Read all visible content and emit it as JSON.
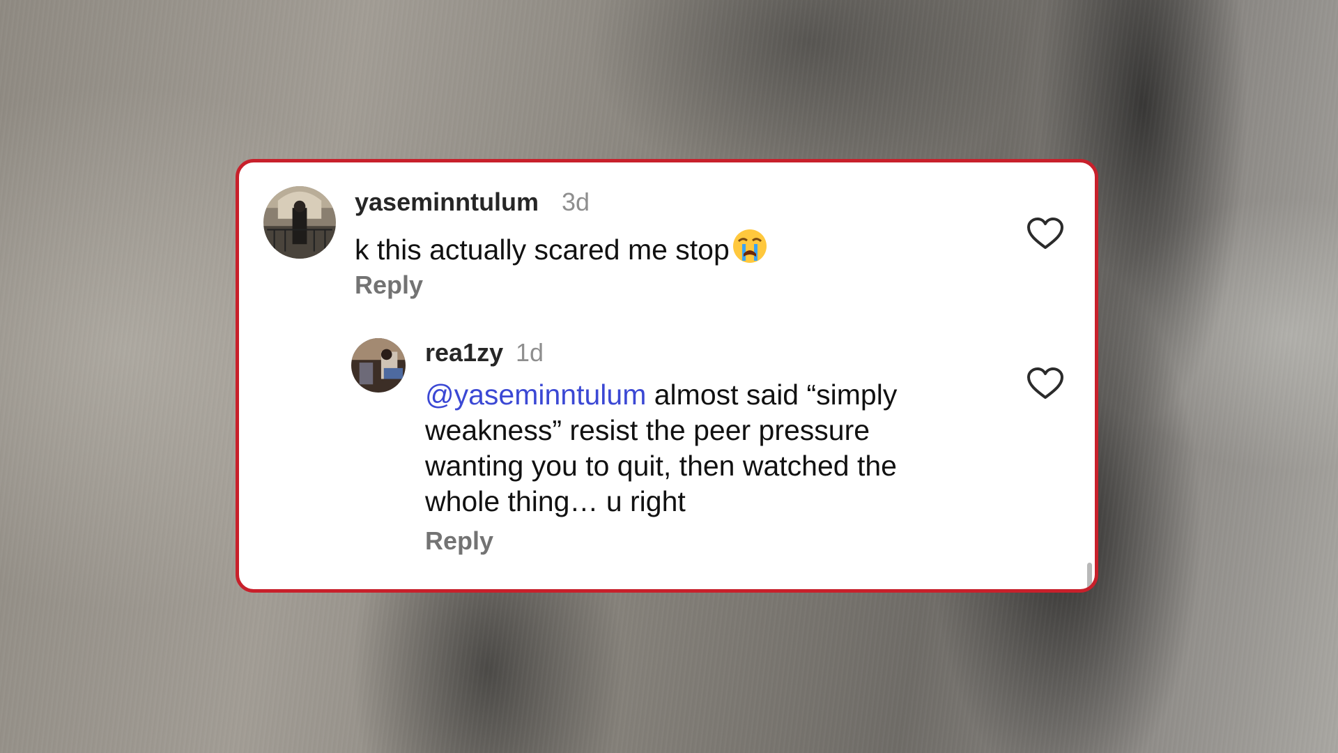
{
  "comments": [
    {
      "username": "yaseminntulum",
      "time": "3d",
      "text": "k this actually scared me stop",
      "emoji": "loudly-crying-face",
      "reply_label": "Reply",
      "like_icon": "heart-outline-icon"
    },
    {
      "username": "rea1zy",
      "time": "1d",
      "mention": "@yaseminntulum",
      "text_line1": " almost said “simply",
      "text_line2": "weakness” resist the peer pressure",
      "text_line3": "wanting you to quit, then watched the",
      "text_line4": "whole thing… u right",
      "reply_label": "Reply",
      "like_icon": "heart-outline-icon"
    }
  ],
  "colors": {
    "frame_border": "#c8202b",
    "mention": "#3b48d4",
    "timestamp": "#8e8e8e",
    "reply": "#737373"
  }
}
